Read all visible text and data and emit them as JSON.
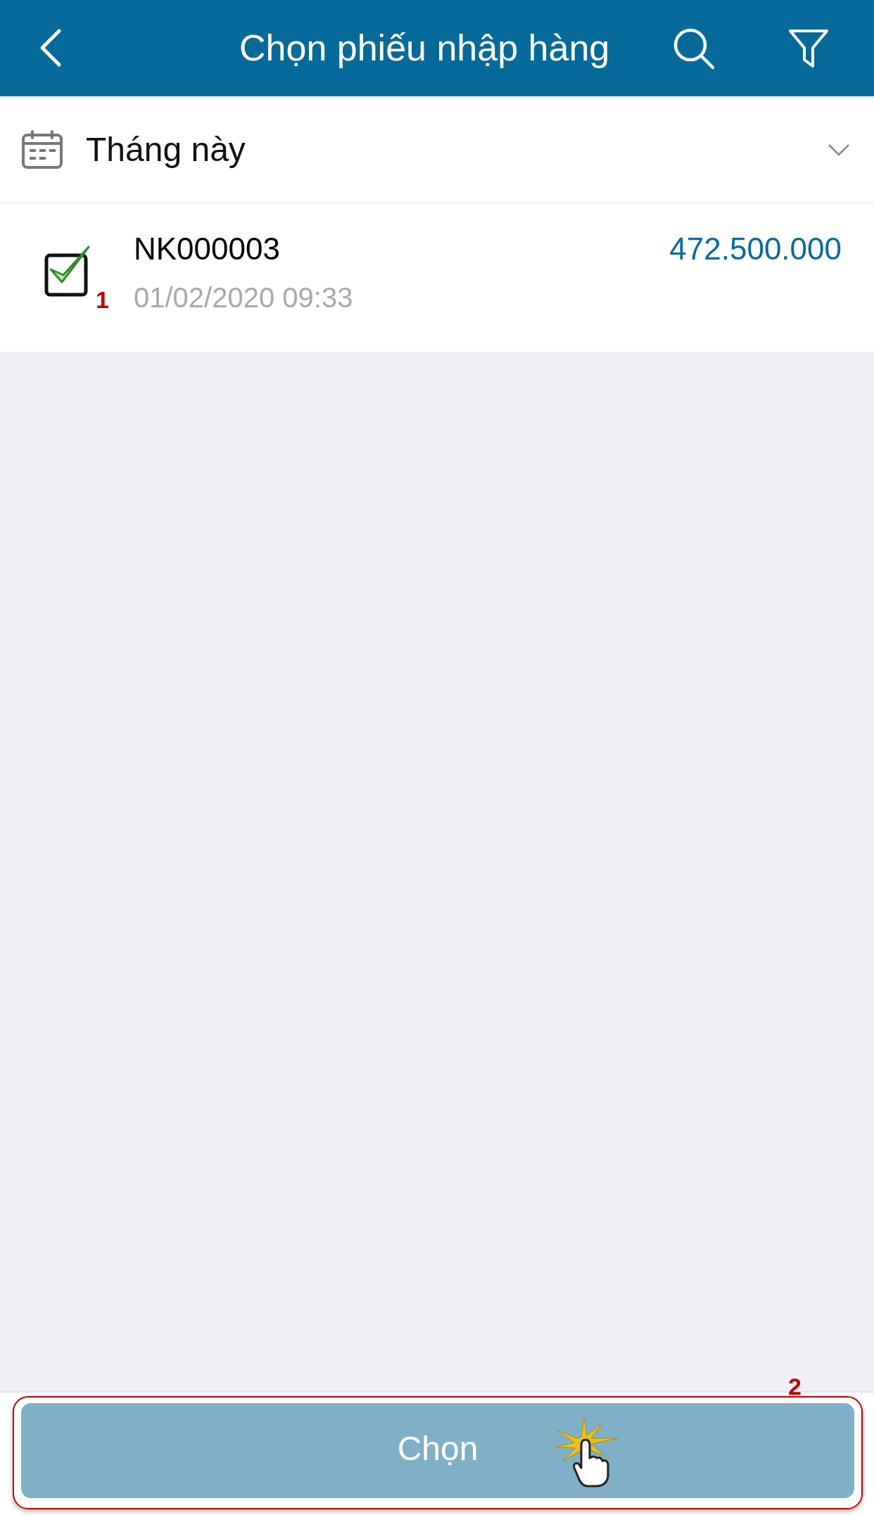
{
  "header": {
    "title": "Chọn phiếu nhập hàng"
  },
  "period_filter": {
    "label": "Tháng này"
  },
  "receipts": [
    {
      "code": "NK000003",
      "datetime": "01/02/2020 09:33",
      "amount": "472.500.000",
      "selected": true,
      "marker": "1"
    }
  ],
  "confirm_button": {
    "label": "Chọn",
    "marker": "2"
  }
}
